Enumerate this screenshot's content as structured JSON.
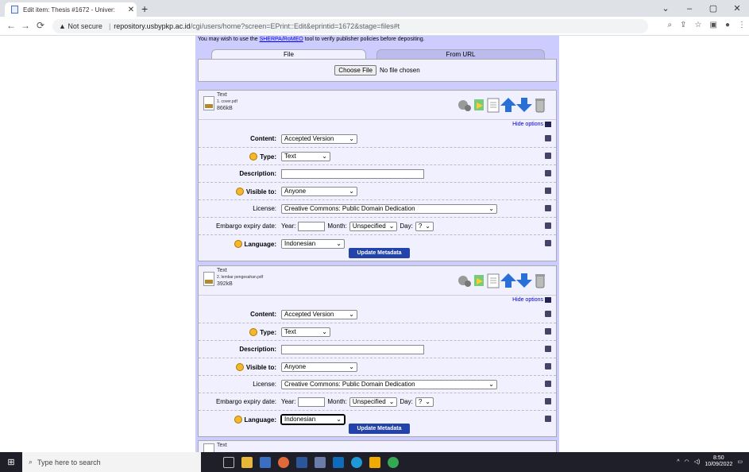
{
  "browser": {
    "tab_title": "Edit item: Thesis #1672 - Univer:",
    "tab_close": "✕",
    "new_tab": "+",
    "window_controls": [
      "⌄",
      "–",
      "▢",
      "✕"
    ],
    "security_label": "▲ Not secure",
    "url_host": "repository.usbypkp.ac.id",
    "url_path": "/cgi/users/home?screen=EPrint::Edit&eprintid=1672&stage=files#t"
  },
  "upload": {
    "sherpa_prefix": "You may wish to use the ",
    "sherpa_link": "SHERPA/RoMEO",
    "sherpa_suffix": " tool to verify publisher policies before depositing.",
    "tabs": [
      "File",
      "From URL"
    ],
    "choose_file": "Choose File",
    "no_file": "No file chosen"
  },
  "documents": [
    {
      "type": "Text",
      "filename": "1. cover.pdf",
      "size": "866kB",
      "hide_options": "Hide options",
      "labels": {
        "content": "Content:",
        "type": "Type:",
        "description": "Description:",
        "visible": "Visible to:",
        "license": "License:",
        "embargo": "Embargo expiry date:",
        "language": "Language:"
      },
      "content": "Accepted Version",
      "type_value": "Text",
      "description": "",
      "visible": "Anyone",
      "license": "Creative Commons: Public Domain Dedication",
      "embargo": {
        "year_label": "Year:",
        "month_label": "Month:",
        "month": "Unspecified",
        "day_label": "Day:",
        "day": "?"
      },
      "language": "Indonesian",
      "update": "Update Metadata"
    },
    {
      "type": "Text",
      "filename": "2. lembar pengesahan.pdf",
      "size": "392kB",
      "hide_options": "Hide options",
      "labels": {
        "content": "Content:",
        "type": "Type:",
        "description": "Description:",
        "visible": "Visible to:",
        "license": "License:",
        "embargo": "Embargo expiry date:",
        "language": "Language:"
      },
      "content": "Accepted Version",
      "type_value": "Text",
      "description": "",
      "visible": "Anyone",
      "license": "Creative Commons: Public Domain Dedication",
      "embargo": {
        "year_label": "Year:",
        "month_label": "Month:",
        "month": "Unspecified",
        "day_label": "Day:",
        "day": "?"
      },
      "language": "Indonesian",
      "update": "Update Metadata"
    },
    {
      "type": "Text"
    }
  ],
  "taskbar": {
    "search_placeholder": "Type here to search",
    "time": "8:50",
    "date": "10/09/2022"
  },
  "colors": {
    "page_bg": "#ccccff",
    "panel_bg": "#f0f0ff",
    "button_blue": "#2244aa"
  }
}
